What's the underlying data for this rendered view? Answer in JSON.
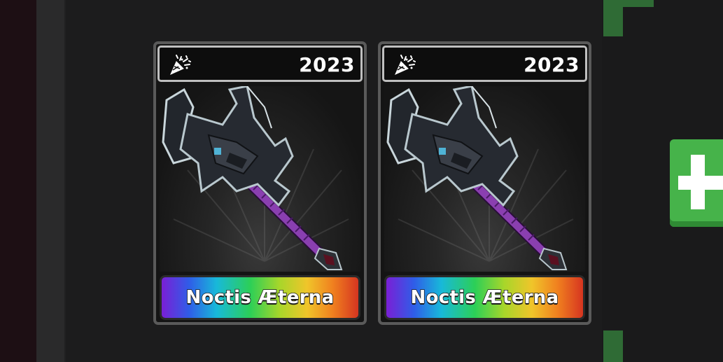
{
  "inventory": {
    "items": [
      {
        "year": "2023",
        "name": "Noctis Æterna",
        "event_icon": "party-popper-icon",
        "rarity_style": "rainbow-gradient"
      },
      {
        "year": "2023",
        "name": "Noctis Æterna",
        "event_icon": "party-popper-icon",
        "rarity_style": "rainbow-gradient"
      }
    ]
  },
  "add_button": {
    "icon": "plus-icon",
    "color": "#46b34a"
  },
  "colors": {
    "background": "#1c1c1d",
    "card_border": "#5a5a5a",
    "weapon_handle": "#8a3fb0",
    "accent_green": "#2f6b35"
  }
}
